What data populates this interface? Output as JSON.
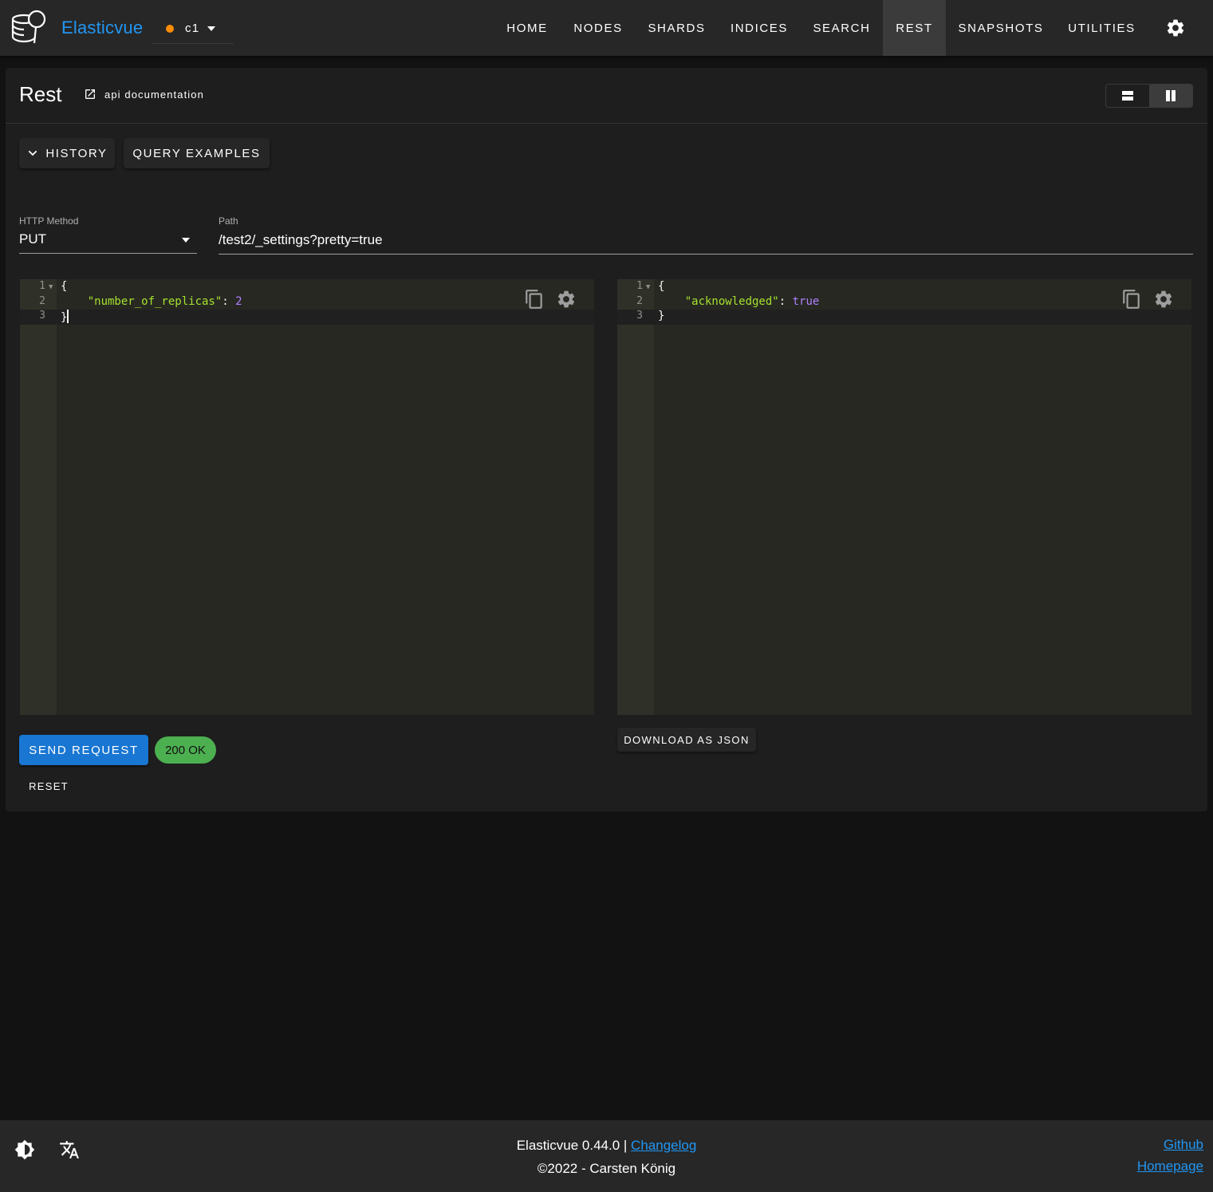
{
  "app": {
    "name": "Elasticvue"
  },
  "cluster": {
    "name": "c1",
    "status_color": "#fb8c00"
  },
  "nav": {
    "items": [
      "HOME",
      "NODES",
      "SHARDS",
      "INDICES",
      "SEARCH",
      "REST",
      "SNAPSHOTS",
      "UTILITIES"
    ],
    "active": "REST"
  },
  "page": {
    "title": "Rest",
    "doc_link": "api documentation"
  },
  "tabs": {
    "history": "HISTORY",
    "query_examples": "QUERY EXAMPLES"
  },
  "form": {
    "method_label": "HTTP Method",
    "method_value": "PUT",
    "path_label": "Path",
    "path_value": "/test2/_settings?pretty=true"
  },
  "request_editor": {
    "line_numbers": [
      "1",
      "2",
      "3"
    ],
    "lines": [
      "{",
      "\"number_of_replicas\"",
      ": ",
      "2",
      "}"
    ],
    "key": "\"number_of_replicas\"",
    "value": "2"
  },
  "response_editor": {
    "line_numbers": [
      "1",
      "2",
      "3"
    ],
    "key": "\"acknowledged\"",
    "value": "true"
  },
  "actions": {
    "send": "SEND REQUEST",
    "status": "200 OK",
    "reset": "RESET",
    "download": "DOWNLOAD AS JSON"
  },
  "footer": {
    "version_text": "Elasticvue 0.44.0 |",
    "changelog": "Changelog",
    "copyright": "©2022 - Carsten König",
    "github": "Github",
    "homepage": "Homepage"
  },
  "colors": {
    "accent": "#2196f3",
    "primary_button": "#1976d2",
    "status_ok": "#4caf50",
    "cluster_status": "#fb8c00"
  }
}
